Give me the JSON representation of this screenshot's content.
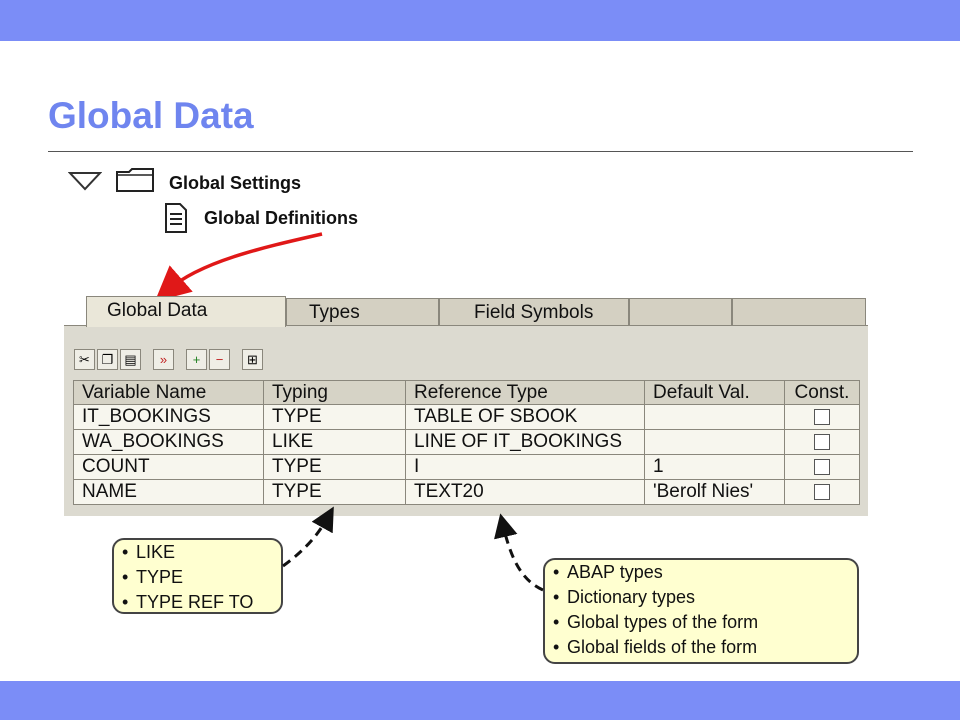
{
  "slide": {
    "title": "Global Data"
  },
  "tree": {
    "folder_label": "Global Settings",
    "doc_label": "Global Definitions",
    "arrow_icon": "triangle-down-icon",
    "folder_icon": "folder-icon",
    "doc_icon": "document-icon"
  },
  "tabs": [
    {
      "label": "Global Data",
      "active": true
    },
    {
      "label": "Types",
      "active": false
    },
    {
      "label": "Field Symbols",
      "active": false
    },
    {
      "label": "",
      "active": false
    },
    {
      "label": "",
      "active": false
    }
  ],
  "toolbar": {
    "icons": [
      "cut-icon",
      "copy-icon",
      "paste-icon",
      "execute-icon",
      "insert-row-icon",
      "delete-row-icon",
      "hierarchy-icon"
    ]
  },
  "table": {
    "columns": [
      "Variable Name",
      "Typing",
      "Reference Type",
      "Default Val.",
      "Const."
    ],
    "rows": [
      {
        "name": "IT_BOOKINGS",
        "typing": "TYPE",
        "reference": "TABLE OF SBOOK",
        "default": "",
        "const": false
      },
      {
        "name": "WA_BOOKINGS",
        "typing": "LIKE",
        "reference": "LINE OF IT_BOOKINGS",
        "default": "",
        "const": false
      },
      {
        "name": "COUNT",
        "typing": "TYPE",
        "reference": "I",
        "default": "1",
        "const": false
      },
      {
        "name": "NAME",
        "typing": "TYPE",
        "reference": "TEXT20",
        "default": "'Berolf Nies'",
        "const": false
      }
    ]
  },
  "callouts": {
    "typing_options": [
      "LIKE",
      "TYPE",
      "TYPE REF TO"
    ],
    "reference_options": [
      "ABAP types",
      "Dictionary types",
      "Global types of the form",
      "Global fields of the form"
    ]
  },
  "colors": {
    "accent_bar": "#7b8df7",
    "title": "#6f85ef",
    "callout_fill": "#ffffd0",
    "arrow_red": "#e01818"
  }
}
